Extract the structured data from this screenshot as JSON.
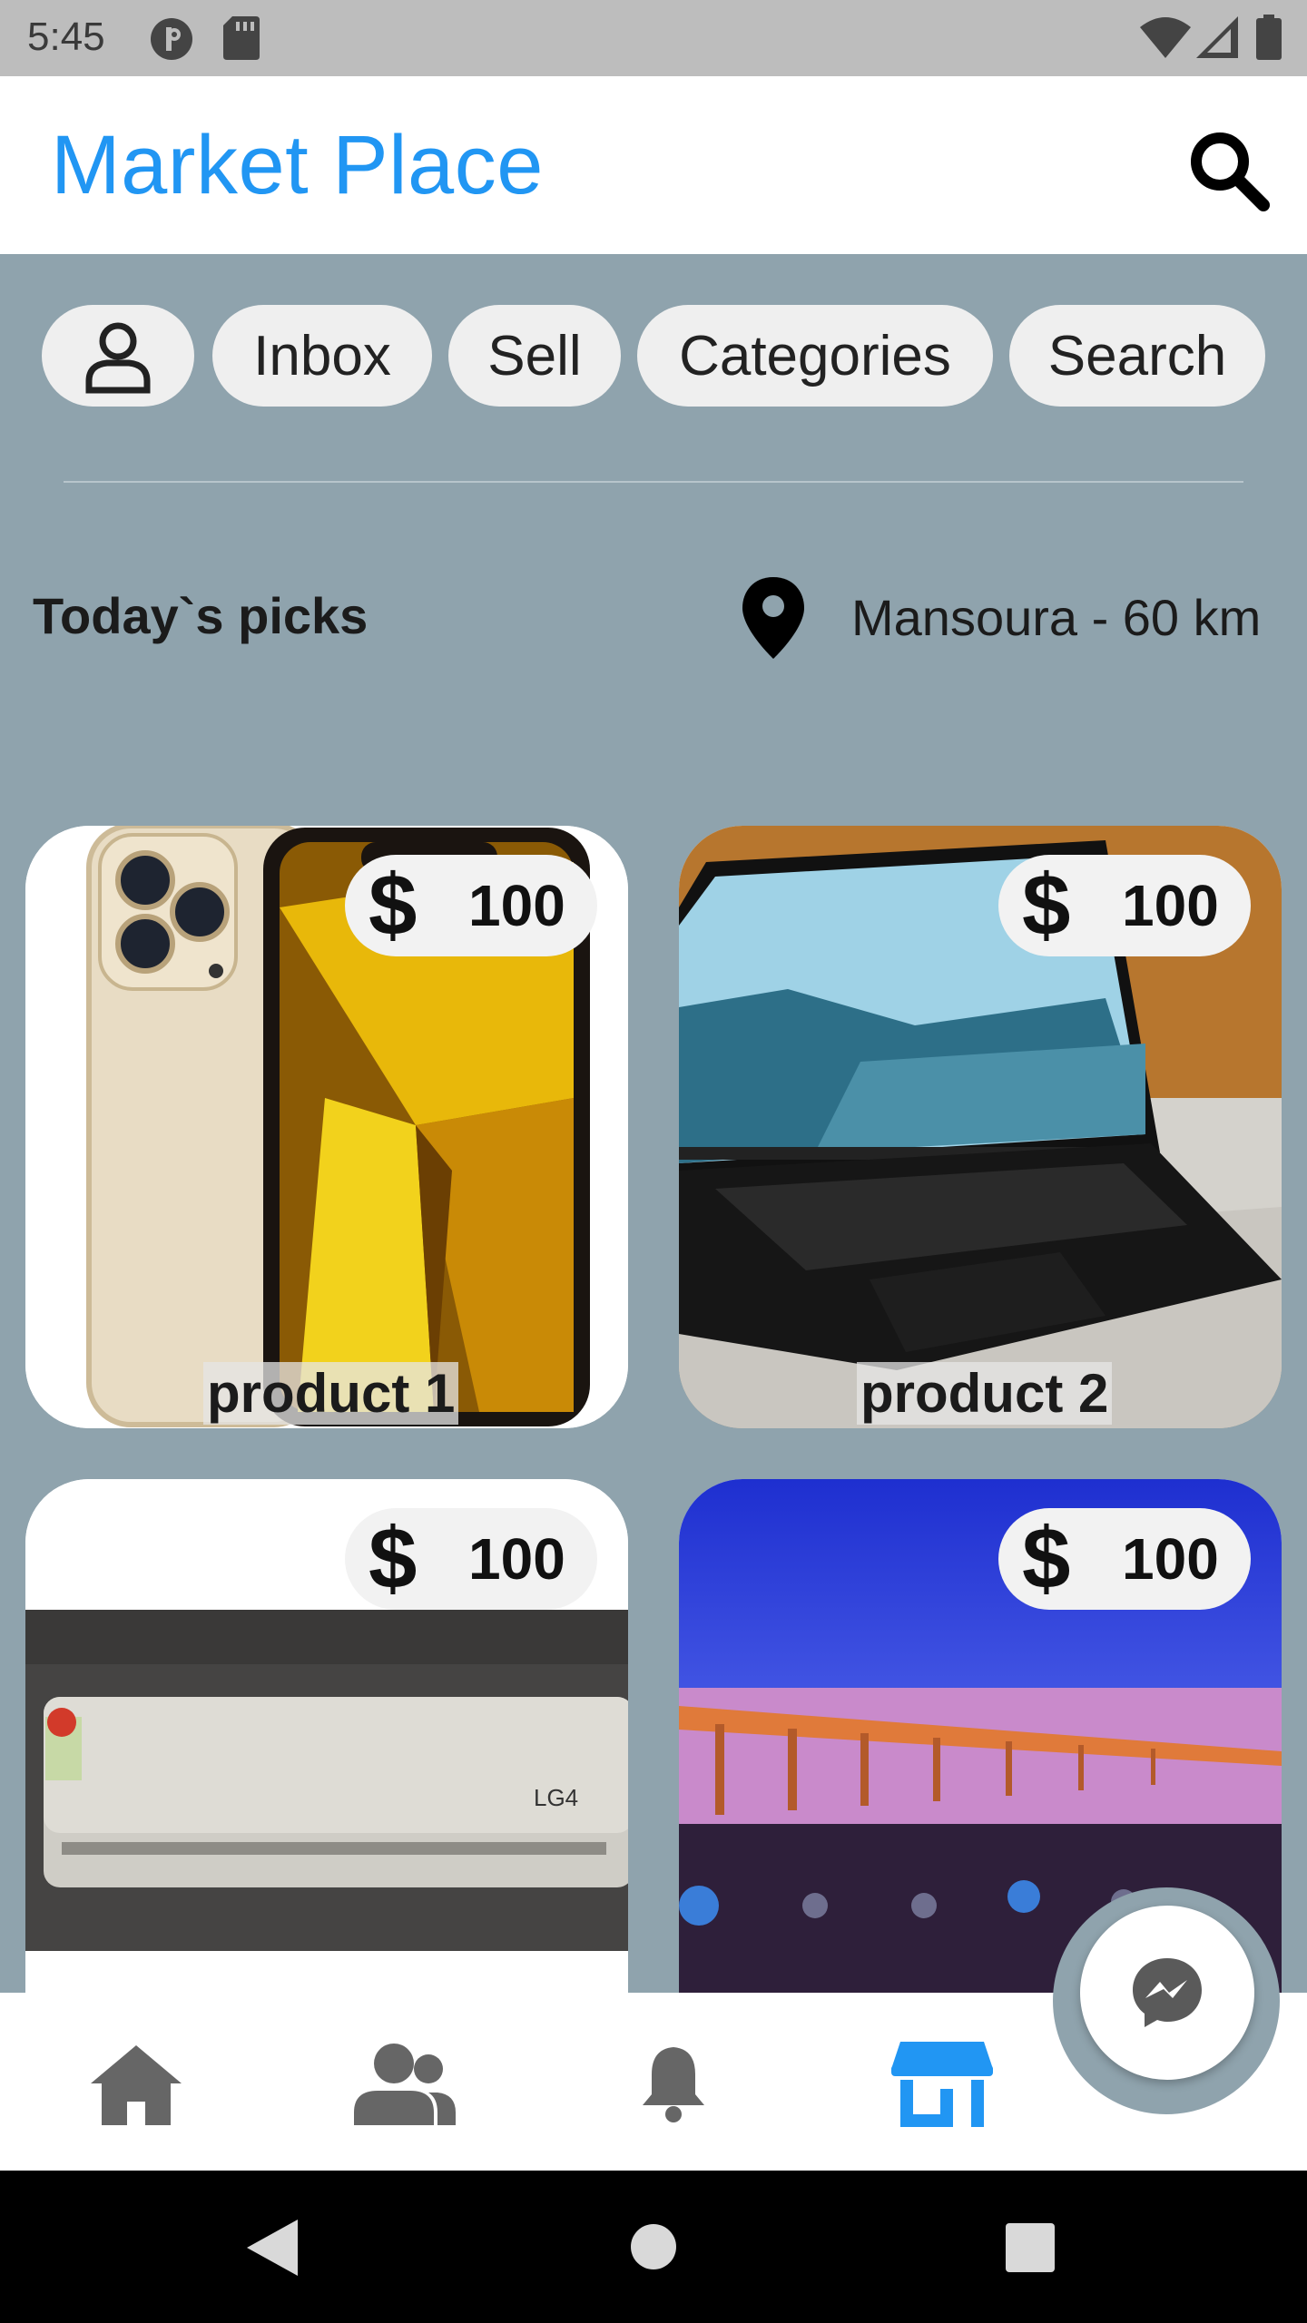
{
  "status_bar": {
    "time": "5:45",
    "icons": [
      "notification-p-icon",
      "sd-card-icon",
      "wifi-icon",
      "signal-icon",
      "battery-icon"
    ]
  },
  "app_bar": {
    "title": "Market Place",
    "title_color": "#2196f3",
    "search_icon": "search-icon"
  },
  "chips": {
    "profile_icon": "person-icon",
    "inbox": "Inbox",
    "sell": "Sell",
    "categories": "Categories",
    "search": "Search"
  },
  "picks": {
    "title": "Today`s picks",
    "location_icon": "location-pin-icon",
    "location": "Mansoura - 60 km"
  },
  "products": [
    {
      "name": "product 1",
      "currency_icon": "$",
      "price": "100",
      "image": "gold-smartphone"
    },
    {
      "name": "product 2",
      "currency_icon": "$",
      "price": "100",
      "image": "black-laptop"
    },
    {
      "name": "",
      "currency_icon": "$",
      "price": "100",
      "image": "air-conditioner"
    },
    {
      "name": "",
      "currency_icon": "$",
      "price": "100",
      "image": "tv-screen-pier"
    }
  ],
  "bottom_nav": {
    "items": [
      "home-icon",
      "friends-icon",
      "notifications-icon",
      "marketplace-icon"
    ],
    "active": "marketplace-icon",
    "active_color": "#2196f3",
    "inactive_color": "#666666",
    "fab_icon": "messenger-icon"
  },
  "system_nav": [
    "back-icon",
    "home-circle-icon",
    "recents-icon"
  ]
}
